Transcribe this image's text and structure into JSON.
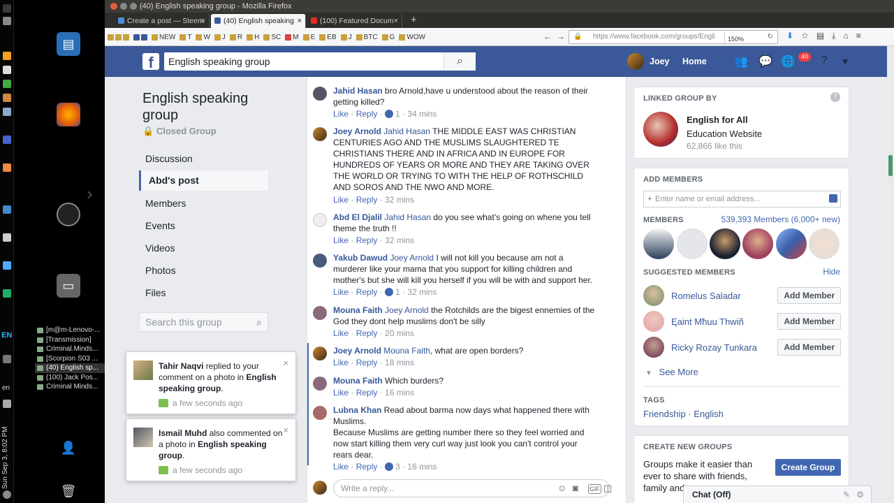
{
  "window": {
    "title": "(40) English speaking group - Mozilla Firefox"
  },
  "browser": {
    "tabs": [
      {
        "label": "Create a post — Steem",
        "color": "#4a90d9"
      },
      {
        "label": "(40) English speaking",
        "color": "#3b5998"
      },
      {
        "label": "(100) Featured Docum",
        "color": "#e52d27"
      }
    ],
    "url": "https://www.facebook.com/groups/Engli",
    "zoom": "150%",
    "bookmarks": [
      "NEW",
      "T",
      "W",
      "J",
      "R",
      "H",
      "SC",
      "M",
      "E",
      "EB",
      "J",
      "BTC",
      "G",
      "WOW"
    ]
  },
  "desktop": {
    "clock": "Sun Sep 3, 8:02 PM",
    "keyboard": "EN",
    "lang": "en",
    "windows": [
      "[m@m-Lenovo-...",
      "[Transmission]",
      "Criminal.Minds...",
      "[Scorpion S03 ...",
      "(40) English sp...",
      "(100) Jack Pos...",
      "Criminal Minds..."
    ]
  },
  "header": {
    "search": "English speaking group",
    "user": "Joey",
    "home": "Home",
    "notif_count": "40"
  },
  "group": {
    "title": "English speaking group",
    "type": "Closed Group",
    "nav": [
      "Discussion",
      "Abd's post",
      "Members",
      "Events",
      "Videos",
      "Photos",
      "Files"
    ],
    "search_placeholder": "Search this group"
  },
  "comments": [
    {
      "author": "Jahid Hasan",
      "tag": "",
      "text": "bro Arnold,have u understood about the reason of their getting killed?",
      "likes": "1",
      "time": "34 mins"
    },
    {
      "author": "Joey Arnold",
      "tag": "Jahid Hasan",
      "text": "THE MIDDLE EAST WAS CHRISTIAN CENTURIES AGO AND THE MUSLIMS SLAUGHTERED TE CHRISTIANS THERE AND IN AFRICA AND IN EUROPE FOR HUNDREDS OF YEARS OR MORE AND THEY ARE TAKING OVER THE WORLD OR TRYING TO WITH THE HELP OF ROTHSCHILD AND SOROS AND THE NWO AND MORE.",
      "likes": "",
      "time": "32 mins"
    },
    {
      "author": "Abd El Djalil",
      "tag": "Jahid Hasan",
      "text": "do you see what's going on whene you tell theme the truth !!",
      "likes": "",
      "time": "32 mins"
    },
    {
      "author": "Yakub Dawud",
      "tag": "Joey Arnold",
      "text": "I will not kill you because am not a murderer like your mama that you support for killing children and mother's but she will kill you herself if you will be with and support her.",
      "likes": "1",
      "time": "32 mins"
    },
    {
      "author": "Mouna Faith",
      "tag": "Joey Arnold",
      "text": "the Rotchilds are the bigest ennemies of the God they dont help muslims don't be silly",
      "likes": "",
      "time": "20 mins"
    },
    {
      "author": "Joey Arnold",
      "tag": "Mouna Faith",
      "text": ", what are open borders?",
      "likes": "",
      "time": "18 mins"
    },
    {
      "author": "Mouna Faith",
      "tag": "",
      "text": "Which burders?",
      "likes": "",
      "time": "16 mins"
    },
    {
      "author": "Lubna Khan",
      "tag": "",
      "text": "Read about barma now days what happened there with Muslims.\nBecause Muslims are getting number there so they feel worried and now start killing them very curl way just look you can't control your rears dear.",
      "likes": "3",
      "time": "16 mins"
    }
  ],
  "actions": {
    "like": "Like",
    "reply": "Reply",
    "reply_placeholder": "Write a reply..."
  },
  "linked": {
    "heading": "LINKED GROUP BY",
    "name": "English for All",
    "category": "Education Website",
    "likes": "62,866 like this"
  },
  "add_members": {
    "heading": "ADD MEMBERS",
    "placeholder": "Enter name or email address..."
  },
  "members": {
    "heading": "MEMBERS",
    "count": "539,393 Members (6,000+ new)"
  },
  "suggested": {
    "heading": "SUGGESTED MEMBERS",
    "hide": "Hide",
    "add_label": "Add Member",
    "see_more": "See More",
    "people": [
      "Romelus Saladar",
      "Ęaint Mħuu Thwiñ",
      "Ricky Rozay Tunkara"
    ]
  },
  "tags": {
    "heading": "TAGS",
    "values": "Friendship · English"
  },
  "create_groups": {
    "heading": "CREATE NEW GROUPS",
    "text": "Groups make it easier than ever to share with friends, family and",
    "button": "Create Group"
  },
  "chat": {
    "label": "Chat (Off)"
  },
  "toasts": [
    {
      "name": "Tahir Naqvi",
      "text": " replied to your comment on a photo in ",
      "group": "English speaking group",
      "time": "a few seconds ago"
    },
    {
      "name": "Ismail Muhd",
      "text": " also commented on a photo in ",
      "group": "English speaking group",
      "time": "a few seconds ago"
    }
  ],
  "colors": {
    "brand": "#3b5998",
    "link": "#365899",
    "accent": "#4267b2"
  }
}
